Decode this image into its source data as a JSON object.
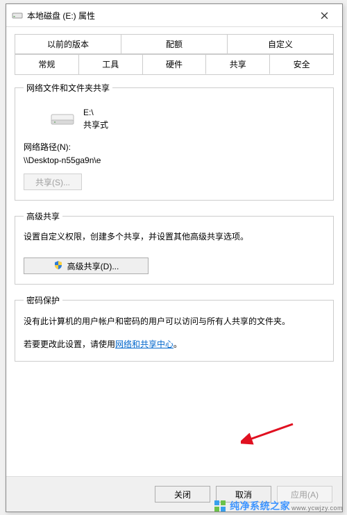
{
  "window": {
    "title": "本地磁盘 (E:) 属性"
  },
  "tabs_row1": [
    "以前的版本",
    "配额",
    "自定义"
  ],
  "tabs_row2": [
    "常规",
    "工具",
    "硬件",
    "共享",
    "安全"
  ],
  "active_tab": "共享",
  "share": {
    "legend": "网络文件和文件夹共享",
    "drive_path": "E:\\",
    "drive_state": "共享式",
    "net_path_label": "网络路径(N):",
    "net_path_value": "\\\\Desktop-n55ga9n\\e",
    "share_btn": "共享(S)..."
  },
  "advanced": {
    "legend": "高级共享",
    "text": "设置自定义权限，创建多个共享，并设置其他高级共享选项。",
    "button": "高级共享(D)..."
  },
  "password": {
    "legend": "密码保护",
    "line1": "没有此计算机的用户帐户和密码的用户可以访问与所有人共享的文件夹。",
    "line2_pre": "若要更改此设置，请使用",
    "link": "网络和共享中心",
    "line2_post": "。"
  },
  "buttons": {
    "close": "关闭",
    "cancel": "取消",
    "apply": "应用(A)"
  },
  "watermark": {
    "brand": "纯净系统之家",
    "url": "www.ycwjzy.com"
  }
}
